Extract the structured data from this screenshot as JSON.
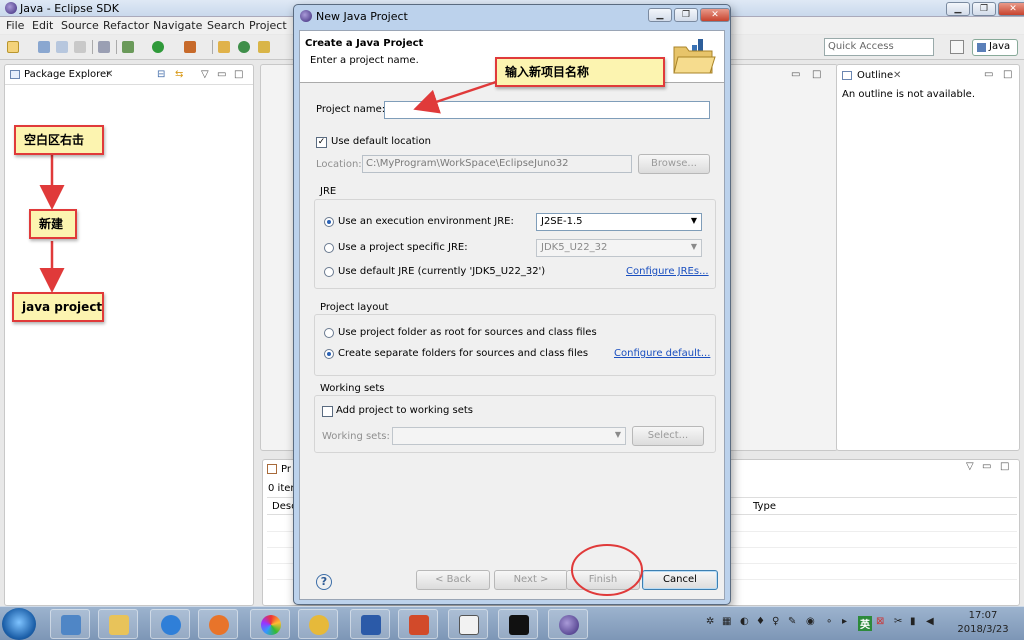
{
  "eclipse": {
    "title": "Java - Eclipse SDK",
    "menu": [
      "File",
      "Edit",
      "Source",
      "Refactor",
      "Navigate",
      "Search",
      "Project"
    ],
    "quick_access": "Quick Access",
    "perspective": "Java"
  },
  "package_explorer": {
    "title": "Package Explorer"
  },
  "outline": {
    "title": "Outline",
    "message": "An outline is not available."
  },
  "problems": {
    "title": "Pr",
    "count": "0 item",
    "col_desc": "Desc",
    "col_type": "Type"
  },
  "dialog": {
    "title": "New Java Project",
    "header": "Create a Java Project",
    "subheader": "Enter a project name.",
    "project_name_label": "Project name:",
    "project_name_value": "",
    "use_default_location": "Use default location",
    "location_label": "Location:",
    "location_value": "C:\\MyProgram\\WorkSpace\\EclipseJuno32",
    "browse": "Browse...",
    "jre": {
      "title": "JRE",
      "opt_env": "Use an execution environment JRE:",
      "env_value": "J2SE-1.5",
      "opt_specific": "Use a project specific JRE:",
      "specific_value": "JDK5_U22_32",
      "opt_default": "Use default JRE (currently 'JDK5_U22_32')",
      "configure": "Configure JREs..."
    },
    "layout": {
      "title": "Project layout",
      "opt_root": "Use project folder as root for sources and class files",
      "opt_separate": "Create separate folders for sources and class files",
      "configure": "Configure default..."
    },
    "working_sets": {
      "title": "Working sets",
      "add": "Add project to working sets",
      "label": "Working sets:",
      "select": "Select..."
    },
    "buttons": {
      "back": "< Back",
      "next": "Next >",
      "finish": "Finish",
      "cancel": "Cancel"
    }
  },
  "annotations": {
    "enter_name": "输入新项目名称",
    "right_click": "空白区右击",
    "new": "新建",
    "java_project": "java project"
  },
  "taskbar": {
    "ime": "英",
    "time": "17:07",
    "date": "2018/3/23"
  },
  "colors": {
    "annotation_red": "#e03a3a",
    "note_bg": "#fcf4b0",
    "link": "#1a4fbf"
  }
}
